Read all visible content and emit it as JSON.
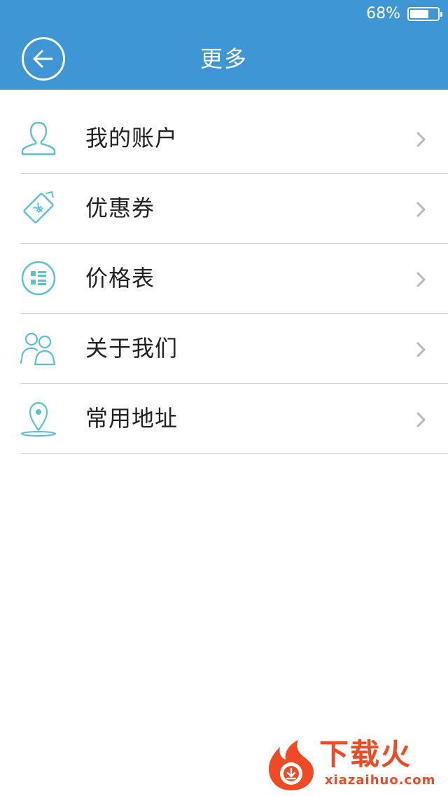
{
  "status_bar": {
    "battery_percent": "68%",
    "battery_level": 0.68
  },
  "header": {
    "title": "更多",
    "accent_color": "#3f96d5"
  },
  "menu": {
    "items": [
      {
        "label": "我的账户",
        "icon": "user-icon"
      },
      {
        "label": "优惠券",
        "icon": "coupon-icon"
      },
      {
        "label": "价格表",
        "icon": "price-list-icon"
      },
      {
        "label": "关于我们",
        "icon": "team-icon"
      },
      {
        "label": "常用地址",
        "icon": "location-pin-icon"
      }
    ],
    "icon_color": "#5bc0cf",
    "chevron_color": "#b9b9b9"
  },
  "watermark": {
    "title": "下载火",
    "url": "xiazaihuo.com",
    "color": "#ef4a23"
  }
}
